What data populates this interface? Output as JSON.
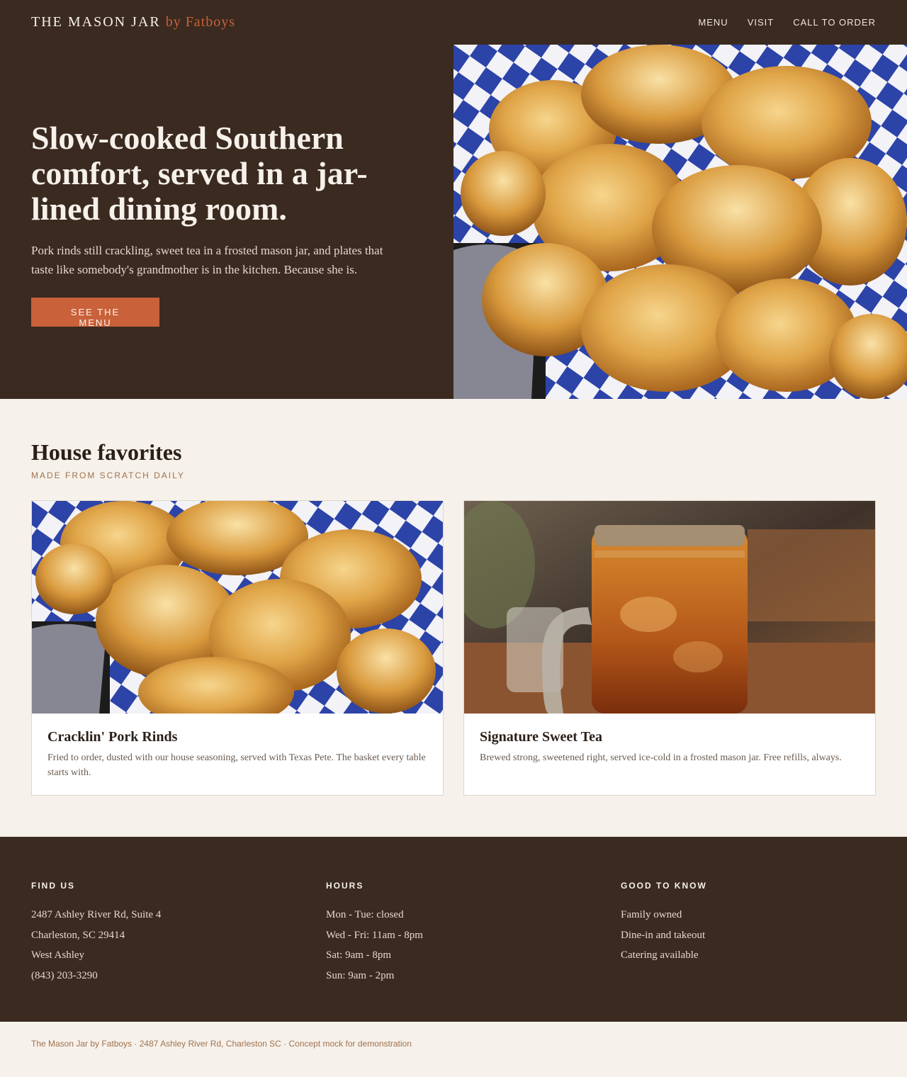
{
  "header": {
    "brand_main": "THE MASON JAR",
    "brand_by": "by Fatboys",
    "nav": [
      "MENU",
      "VISIT",
      "CALL TO ORDER"
    ]
  },
  "hero": {
    "title": "Slow-cooked Southern comfort, served in a jar-lined dining room.",
    "subtitle": "Pork rinds still crackling, sweet tea in a frosted mason jar, and plates that taste like somebody's grandmother is in the kitchen. Because she is.",
    "cta": "SEE THE MENU"
  },
  "favorites": {
    "title": "House favorites",
    "subtitle": "MADE FROM SCRATCH DAILY",
    "cards": [
      {
        "name": "Cracklin' Pork Rinds",
        "desc": "Fried to order, dusted with our house seasoning, served with Texas Pete. The basket every table starts with."
      },
      {
        "name": "Signature Sweet Tea",
        "desc": "Brewed strong, sweetened right, served ice-cold in a frosted mason jar. Free refills, always."
      }
    ]
  },
  "info": {
    "find_us": {
      "heading": "FIND US",
      "lines": [
        "2487 Ashley River Rd, Suite 4",
        "Charleston, SC 29414",
        "West Ashley",
        "(843) 203-3290"
      ]
    },
    "hours": {
      "heading": "HOURS",
      "lines": [
        "Mon - Tue: closed",
        "Wed - Fri: 11am - 8pm",
        "Sat: 9am - 8pm",
        "Sun: 9am - 2pm"
      ]
    },
    "good_to_know": {
      "heading": "GOOD TO KNOW",
      "lines": [
        "Family owned",
        "Dine-in and takeout",
        "Catering available"
      ]
    }
  },
  "footer": {
    "text": "The Mason Jar by Fatboys · 2487 Ashley River Rd, Charleston SC · Concept mock for demonstration"
  }
}
